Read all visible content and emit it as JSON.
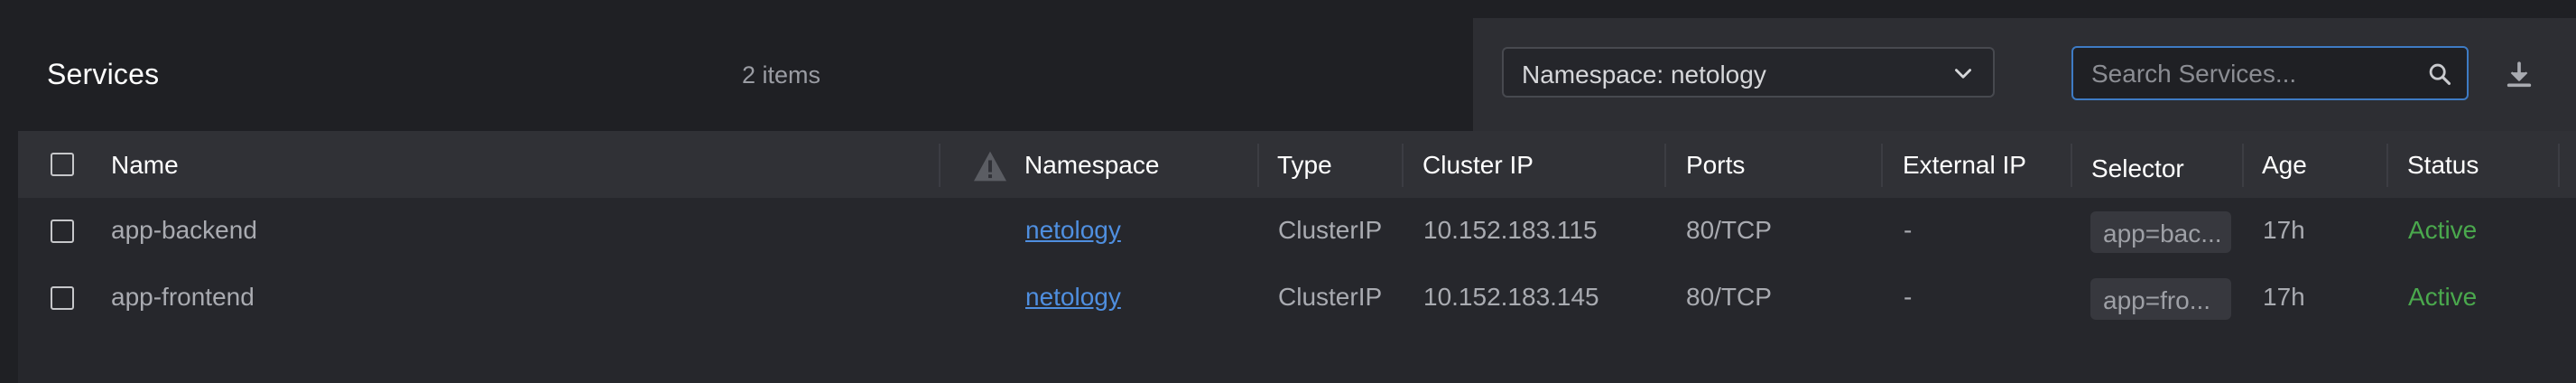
{
  "header": {
    "title": "Services",
    "item_count": "2 items",
    "namespace_select": "Namespace: netology",
    "search_placeholder": "Search Services..."
  },
  "table": {
    "columns": {
      "name": "Name",
      "namespace": "Namespace",
      "type": "Type",
      "cluster_ip": "Cluster IP",
      "ports": "Ports",
      "external_ip": "External IP",
      "selector": "Selector",
      "age": "Age",
      "status": "Status"
    },
    "rows": [
      {
        "name": "app-backend",
        "namespace": "netology",
        "type": "ClusterIP",
        "cluster_ip": "10.152.183.115",
        "ports": "80/TCP",
        "external_ip": "-",
        "selector": "app=bac...",
        "age": "17h",
        "status": "Active"
      },
      {
        "name": "app-frontend",
        "namespace": "netology",
        "type": "ClusterIP",
        "cluster_ip": "10.152.183.145",
        "ports": "80/TCP",
        "external_ip": "-",
        "selector": "app=fro...",
        "age": "17h",
        "status": "Active"
      }
    ]
  },
  "icons": {
    "warning": "warning-icon",
    "chevron": "chevron-down-icon",
    "search": "search-icon",
    "download": "download-icon"
  },
  "colors": {
    "accent": "#3e7bc4",
    "link": "#4f8fe0",
    "status_active": "#4aa84d"
  }
}
